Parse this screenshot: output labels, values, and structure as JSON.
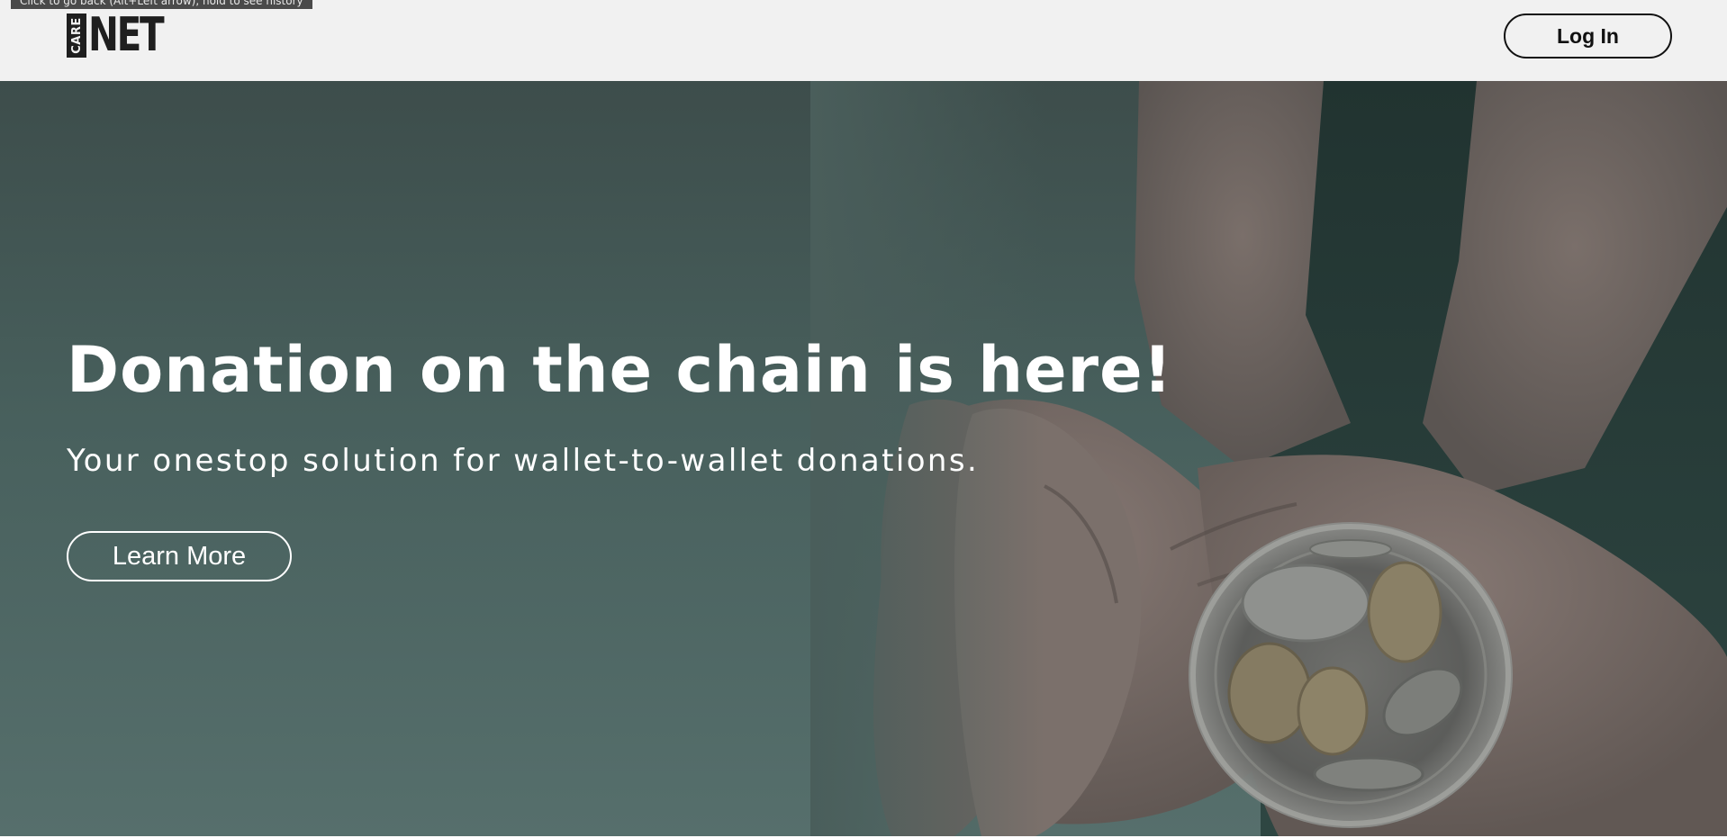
{
  "browser": {
    "back_tooltip": "Click to go back (Alt+Left arrow), hold to see history"
  },
  "header": {
    "logo": {
      "box_text": "CARE",
      "main_text": "NET"
    },
    "login_label": "Log In"
  },
  "hero": {
    "title": "Donation on the chain is here!",
    "subtitle": "Your onestop solution for wallet-to-wallet donations.",
    "cta_label": "Learn More",
    "image_description_icon": "hands-holding-coin-jar-image"
  },
  "colors": {
    "navbar_bg": "#f1f1f1",
    "hero_overlay": "#48605d",
    "text_on_hero": "#ffffff",
    "button_border_dark": "#111111"
  }
}
